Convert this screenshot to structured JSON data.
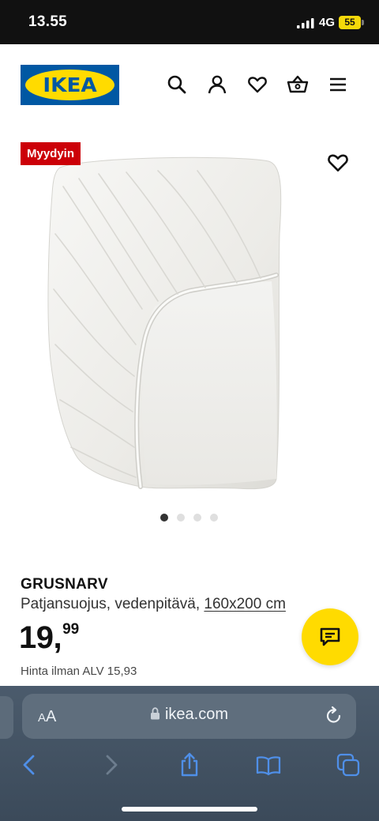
{
  "status_bar": {
    "time": "13.55",
    "network": "4G",
    "battery": "55"
  },
  "header": {
    "logo_text": "IKEA",
    "icons": [
      "search-icon",
      "user-icon",
      "heart-icon",
      "basket-icon",
      "menu-icon"
    ]
  },
  "product": {
    "badge": "Myydyin",
    "name": "GRUSNARV",
    "description": "Patjansuojus, vedenpitävä, ",
    "size": "160x200 cm",
    "price_int": "19,",
    "price_dec": "99",
    "vat_note": "Hinta ilman ALV 15,93",
    "image_count": 4,
    "active_image": 1
  },
  "browser": {
    "aa_small": "A",
    "aa_big": "A",
    "url": "ikea.com"
  },
  "colors": {
    "ikea_blue": "#0058a3",
    "ikea_yellow": "#ffdb00",
    "badge_red": "#cc0008",
    "safari_bar": "#3e4f60",
    "safari_icon_blue": "#4f8fe8"
  }
}
